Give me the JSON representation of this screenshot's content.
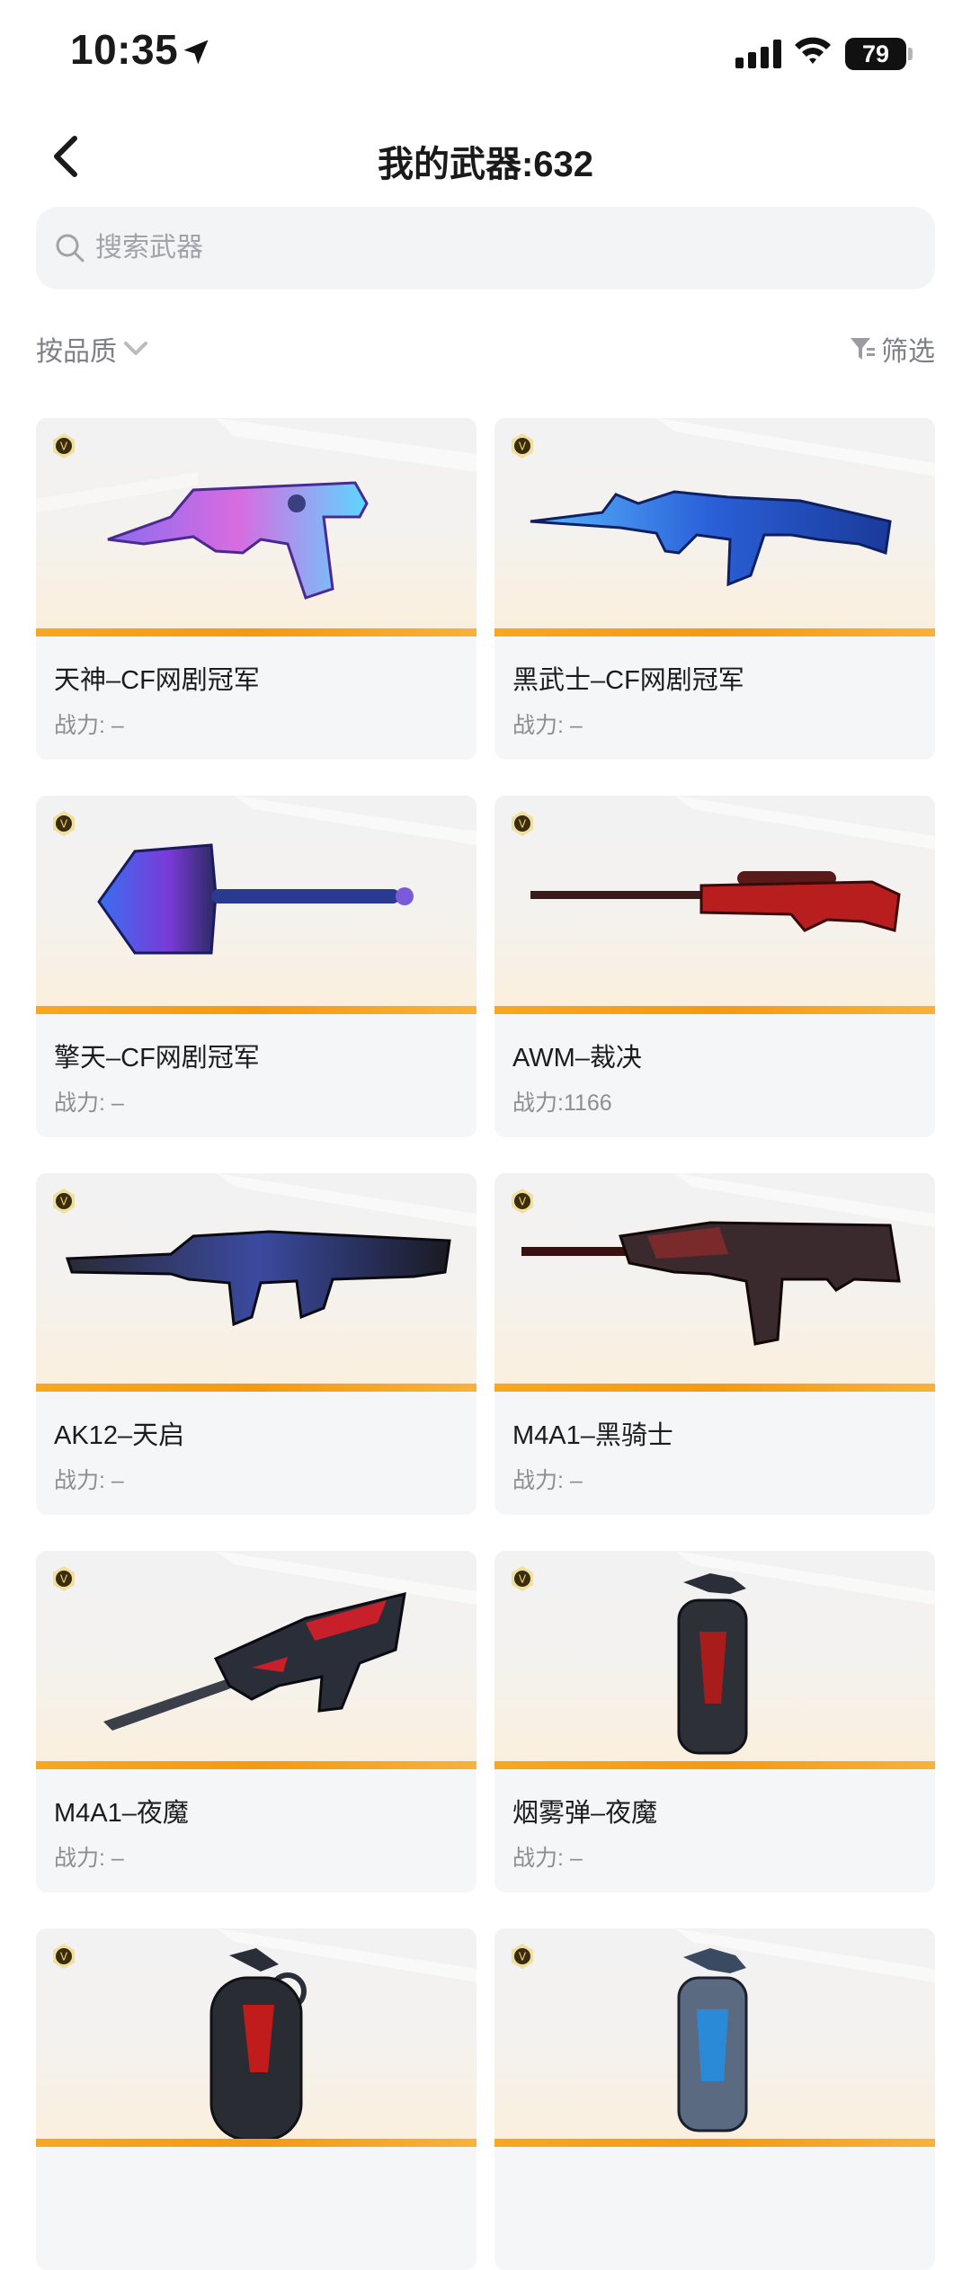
{
  "status_bar": {
    "time": "10:35",
    "battery": "79"
  },
  "header": {
    "title": "我的武器:632"
  },
  "search": {
    "placeholder": "搜索武器"
  },
  "controls": {
    "sort_label": "按品质",
    "filter_label": "筛选"
  },
  "colors": {
    "accent_bar": "#f39a12",
    "card_bg": "#f5f6f8"
  },
  "weapons": [
    {
      "name": "天神–CF网剧冠军",
      "power": "战力: –",
      "icon": "pistol-purple"
    },
    {
      "name": "黑武士–CF网剧冠军",
      "power": "战力: –",
      "icon": "rifle-blue"
    },
    {
      "name": "擎天–CF网剧冠军",
      "power": "战力: –",
      "icon": "axe-blue"
    },
    {
      "name": "AWM–裁决",
      "power": "战力:1166",
      "icon": "sniper-red"
    },
    {
      "name": "AK12–天启",
      "power": "战力: –",
      "icon": "rifle-dark"
    },
    {
      "name": "M4A1–黑骑士",
      "power": "战力: –",
      "icon": "rifle-darkred"
    },
    {
      "name": "M4A1–夜魔",
      "power": "战力: –",
      "icon": "rifle-nightmare"
    },
    {
      "name": "烟雾弹–夜魔",
      "power": "战力: –",
      "icon": "grenade-smoke"
    },
    {
      "name": "",
      "power": "",
      "icon": "grenade-red"
    },
    {
      "name": "",
      "power": "",
      "icon": "grenade-blue"
    }
  ]
}
